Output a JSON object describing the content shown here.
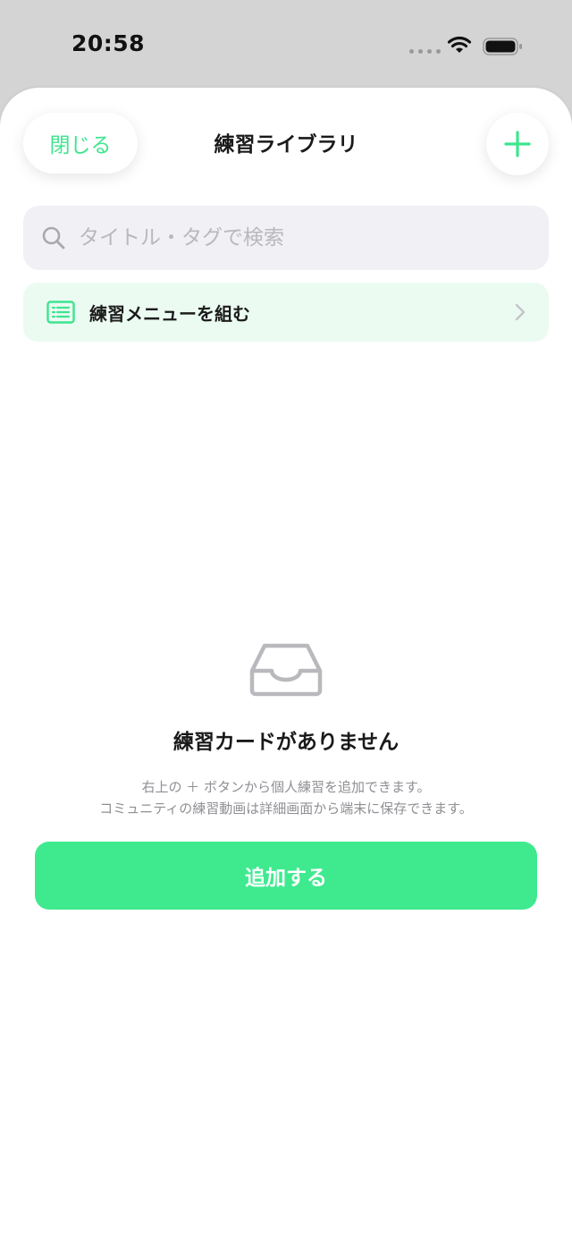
{
  "status_bar": {
    "time": "20:58"
  },
  "header": {
    "close_label": "閉じる",
    "title": "練習ライブラリ",
    "add_icon": "plus-icon"
  },
  "search": {
    "placeholder": "タイトル・タグで検索",
    "value": ""
  },
  "menu_row": {
    "label": "練習メニューを組む",
    "icon": "list-icon"
  },
  "empty_state": {
    "icon": "inbox-tray-icon",
    "title": "練習カードがありません",
    "description_line1": "右上の ＋ ボタンから個人練習を追加できます。",
    "description_line2": "コミュニティの練習動画は詳細画面から端末に保存できます。",
    "action_label": "追加する"
  },
  "colors": {
    "accent": "#3de58f",
    "button": "#3fea8f",
    "menu_row_bg": "#ebfbf2",
    "search_bg": "#f0f0f5"
  }
}
